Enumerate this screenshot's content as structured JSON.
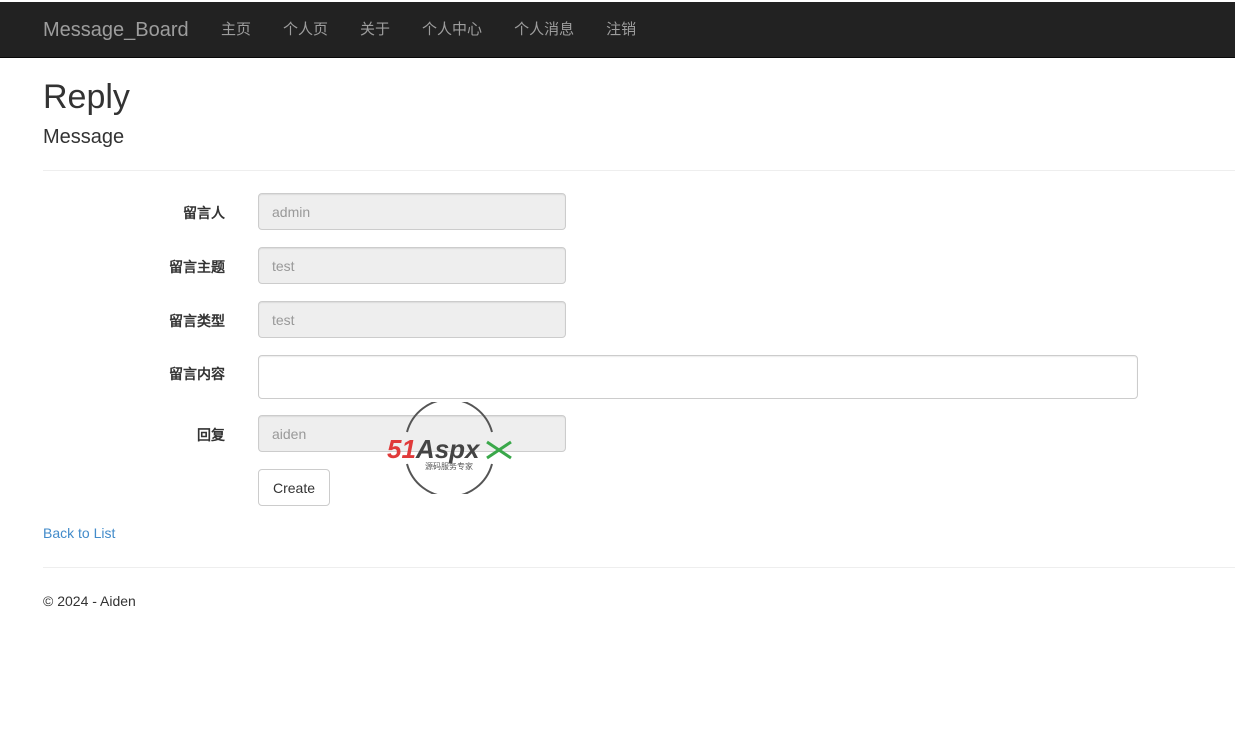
{
  "navbar": {
    "brand": "Message_Board",
    "items": [
      "主页",
      "个人页",
      "关于",
      "个人中心",
      "个人消息",
      "注销"
    ]
  },
  "page": {
    "title": "Reply",
    "subtitle": "Message"
  },
  "form": {
    "fields": [
      {
        "label": "留言人",
        "value": "admin"
      },
      {
        "label": "留言主题",
        "value": "test"
      },
      {
        "label": "留言类型",
        "value": "test"
      },
      {
        "label": "留言内容",
        "value": ""
      },
      {
        "label": "回复",
        "value": "aiden"
      }
    ],
    "submit_label": "Create"
  },
  "back_link": "Back to List",
  "footer": "© 2024 - Aiden",
  "watermark": {
    "brand_red": "51",
    "brand_dark": "Aspx",
    "tagline": "源码服务专家"
  },
  "colors": {
    "navbar_bg": "#222222",
    "link": "#428bca",
    "readonly_bg": "#eeeeee"
  }
}
